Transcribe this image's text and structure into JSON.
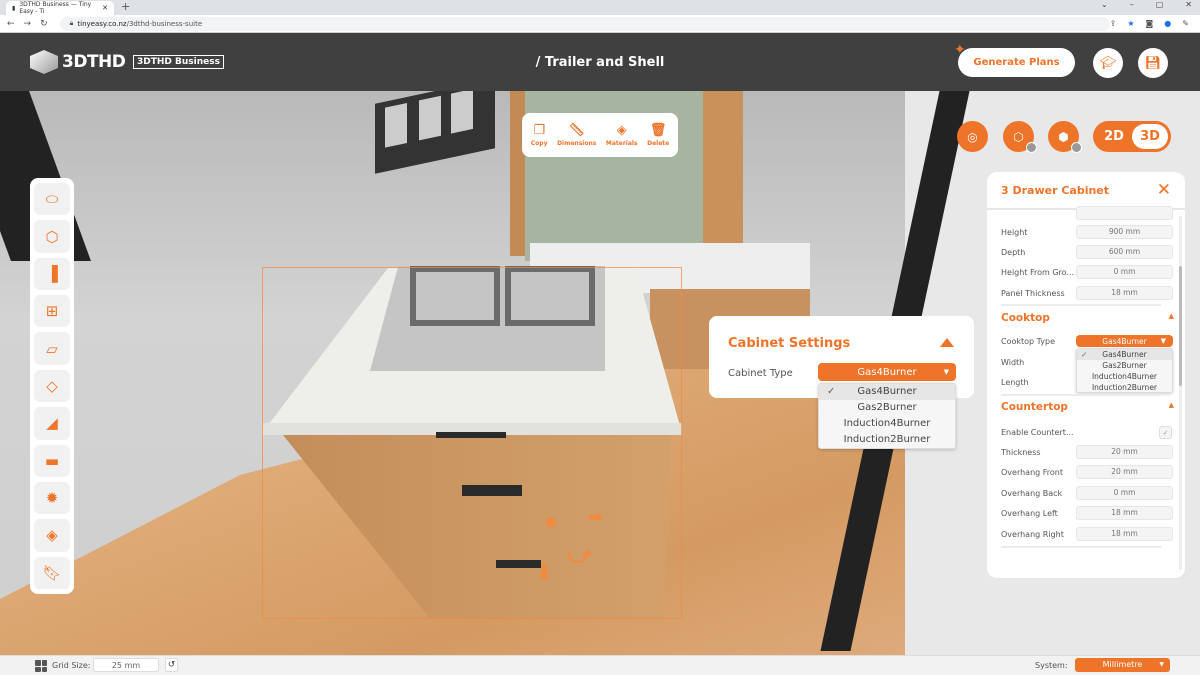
{
  "browser": {
    "tab_title": "3DTHD Business — Tiny Easy - Ti",
    "url_domain": "tinyeasy.co.nz",
    "url_path": "/3dthd-business-suite",
    "new_tab": "+",
    "controls": [
      "⌄",
      "–",
      "▢",
      "✕"
    ]
  },
  "header": {
    "logo_text": "3DTHD",
    "badge": "3DTHD Business",
    "title": "/ Trailer and Shell",
    "generate_plans": "Generate Plans",
    "tutorial_icon": "graduation-cap-icon",
    "save_icon": "floppy-disk-icon"
  },
  "context_toolbar": [
    {
      "label": "Copy",
      "icon": "copy-icon"
    },
    {
      "label": "Dimensions",
      "icon": "ruler-icon"
    },
    {
      "label": "Materials",
      "icon": "paint-bucket-icon"
    },
    {
      "label": "Delete",
      "icon": "trash-icon"
    }
  ],
  "view_controls": {
    "buttons": [
      "tape-measure-icon",
      "floor-view-icon",
      "wall-view-icon"
    ],
    "toggle": {
      "options": [
        "2D",
        "3D"
      ],
      "active": "3D"
    }
  },
  "sidebar": {
    "items": [
      {
        "name": "trailer",
        "icon": "trailer-icon"
      },
      {
        "name": "shell",
        "icon": "cube-icon"
      },
      {
        "name": "doors",
        "icon": "door-icon"
      },
      {
        "name": "windows",
        "icon": "window-icon"
      },
      {
        "name": "walls",
        "icon": "wall-panel-icon"
      },
      {
        "name": "floor",
        "icon": "floor-icon"
      },
      {
        "name": "stairs",
        "icon": "stairs-icon"
      },
      {
        "name": "furniture",
        "icon": "sofa-icon"
      },
      {
        "name": "lighting",
        "icon": "lightbulb-icon"
      },
      {
        "name": "paint",
        "icon": "paint-bucket-icon"
      },
      {
        "name": "bookmarks",
        "icon": "bookmark-icon"
      }
    ]
  },
  "cabinet_settings": {
    "title": "Cabinet Settings",
    "type_label": "Cabinet Type",
    "selected": "Gas4Burner",
    "options": [
      "Gas4Burner",
      "Gas2Burner",
      "Induction4Burner",
      "Induction2Burner"
    ]
  },
  "properties": {
    "title": "3 Drawer Cabinet",
    "rows_top": [
      {
        "label": "Height",
        "value": "900 mm"
      },
      {
        "label": "Depth",
        "value": "600 mm"
      },
      {
        "label": "Height From Gro...",
        "value": "0 mm"
      },
      {
        "label": "Panel Thickness",
        "value": "18 mm"
      }
    ],
    "cooktop": {
      "section": "Cooktop",
      "type_label": "Cooktop Type",
      "selected": "Gas4Burner",
      "options": [
        "Gas4Burner",
        "Gas2Burner",
        "Induction4Burner",
        "Induction2Burner"
      ],
      "width_label": "Width",
      "length_label": "Length"
    },
    "countertop": {
      "section": "Countertop",
      "enable_label": "Enable Countert...",
      "enabled": true,
      "rows": [
        {
          "label": "Thickness",
          "value": "20 mm"
        },
        {
          "label": "Overhang Front",
          "value": "20 mm"
        },
        {
          "label": "Overhang Back",
          "value": "0 mm"
        },
        {
          "label": "Overhang Left",
          "value": "18 mm"
        },
        {
          "label": "Overhang Right",
          "value": "18 mm"
        }
      ]
    }
  },
  "footer": {
    "grid_label": "Grid Size:",
    "grid_value": "25 mm",
    "system_label": "System:",
    "system_value": "Millimetre"
  }
}
